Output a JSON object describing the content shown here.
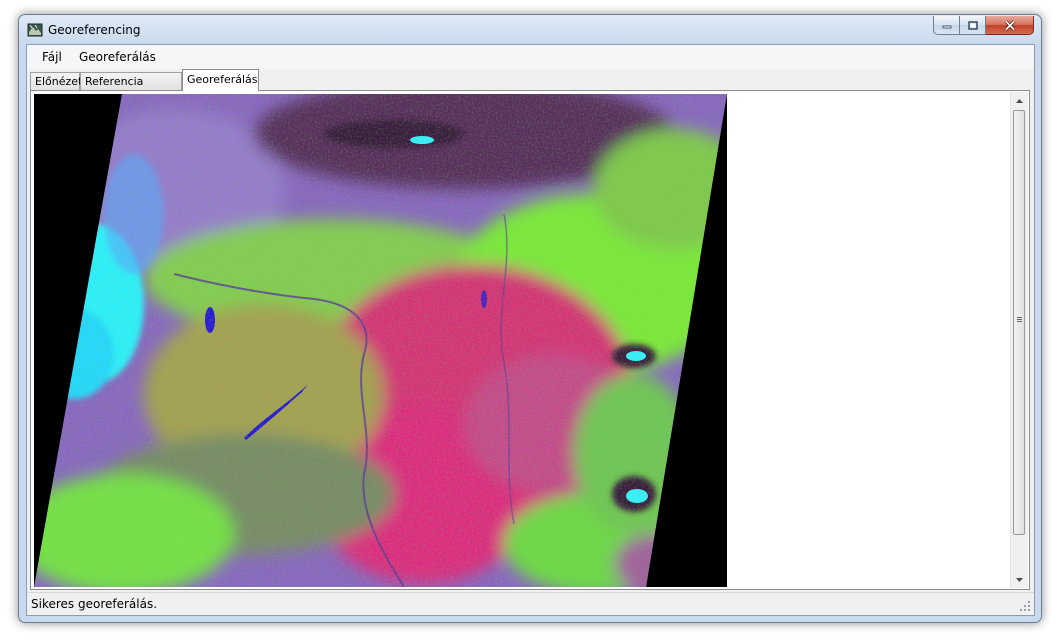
{
  "window": {
    "title": "Georeferencing",
    "icon": "app-map-icon"
  },
  "menu": {
    "items": [
      {
        "label": "Fájl"
      },
      {
        "label": "Georeferálás"
      }
    ]
  },
  "tabs": [
    {
      "label": "Előnézet",
      "active": false
    },
    {
      "label": "Referencia pontok",
      "active": false
    },
    {
      "label": "Georeferálás",
      "active": true
    }
  ],
  "image": {
    "description": "georeferenced satellite image",
    "background": "#000000"
  },
  "status": {
    "text": "Sikeres georeferálás."
  },
  "colors": {
    "titlebar": "#c9daee",
    "close": "#c2412a",
    "satellite_magenta": "#d8307a",
    "satellite_green": "#7ee83c",
    "cloud_cyan": "#2ff0ff",
    "water_blue": "#2a18d6"
  }
}
